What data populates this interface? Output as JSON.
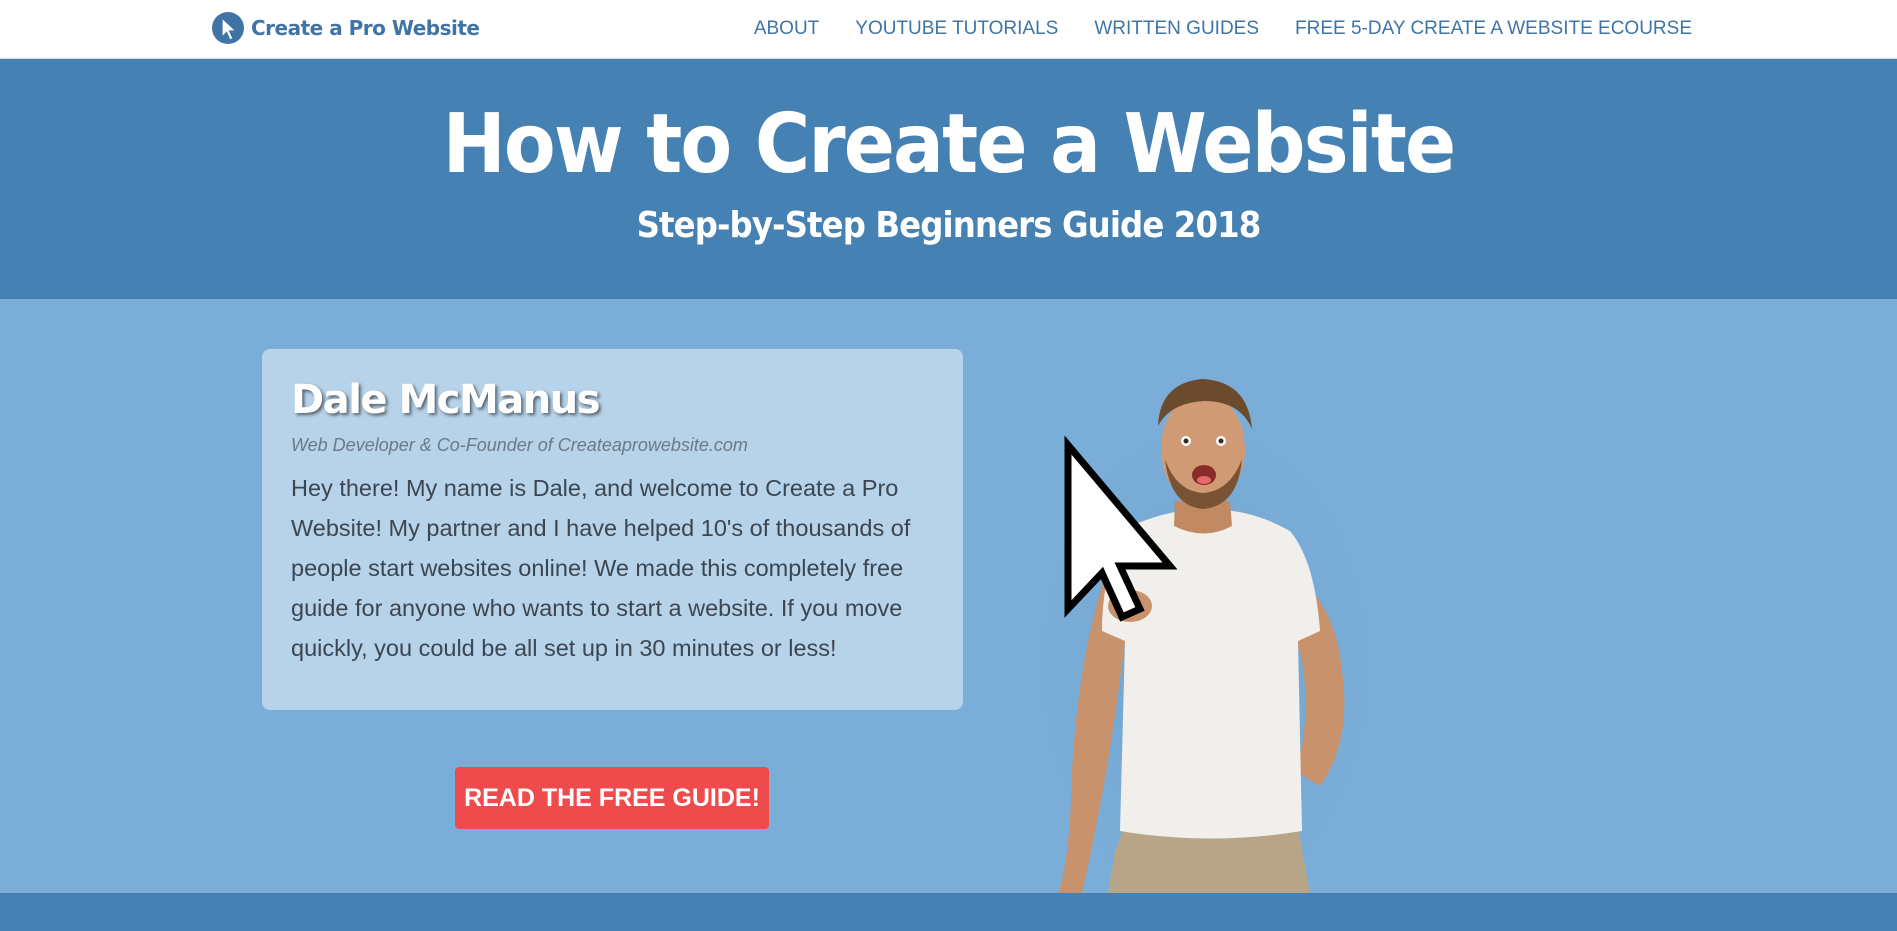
{
  "logo": {
    "text": "Create a Pro Website"
  },
  "nav": {
    "items": [
      {
        "label": "ABOUT"
      },
      {
        "label": "YOUTUBE TUTORIALS"
      },
      {
        "label": "WRITTEN GUIDES"
      },
      {
        "label": "FREE 5-DAY CREATE A WEBSITE ECOURSE"
      }
    ]
  },
  "hero": {
    "title": "How to Create a Website",
    "subtitle": "Step-by-Step Beginners Guide 2018"
  },
  "card": {
    "name": "Dale McManus",
    "role": "Web Developer & Co-Founder of Createaprowebsite.com",
    "body": "Hey there! My name is Dale, and welcome to Create a Pro Website! My partner and I have helped 10's of thousands of people start websites online! We made this completely free guide for anyone who wants to start a website. If you move quickly, you could be all set up in 30 minutes or less!"
  },
  "cta": {
    "label": "READ THE FREE GUIDE!"
  },
  "colors": {
    "brand_blue": "#4581b2",
    "light_blue": "#7aaed8",
    "card_bg": "#b6d3ea",
    "cta_red": "#ef4b4c"
  },
  "icons": {
    "logo": "cursor-globe-icon",
    "photo": "man-pointing-with-cursor-photo"
  }
}
